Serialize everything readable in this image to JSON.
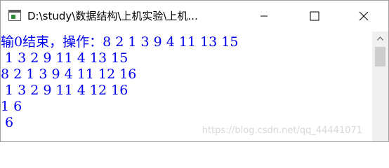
{
  "window": {
    "title": "D:\\study\\数据结构\\上机实验\\上机..."
  },
  "console": {
    "lines": [
      "输0结束，操作：8 2 1 3 9 4 11 13 15",
      " 1 3 2 9 11 4 13 15",
      "8 2 1 3 9 4 11 12 16",
      " 1 3 2 9 11 4 12 16",
      "1 6",
      " 6"
    ],
    "text_color": "#0000ee"
  },
  "watermark": {
    "text": "https://blog.csdn.net/qq_44441071"
  },
  "icons": {
    "app": "console-app-icon",
    "minimize": "minimize-icon",
    "maximize": "maximize-icon",
    "close": "close-icon",
    "scroll_up": "chevron-up-icon"
  }
}
